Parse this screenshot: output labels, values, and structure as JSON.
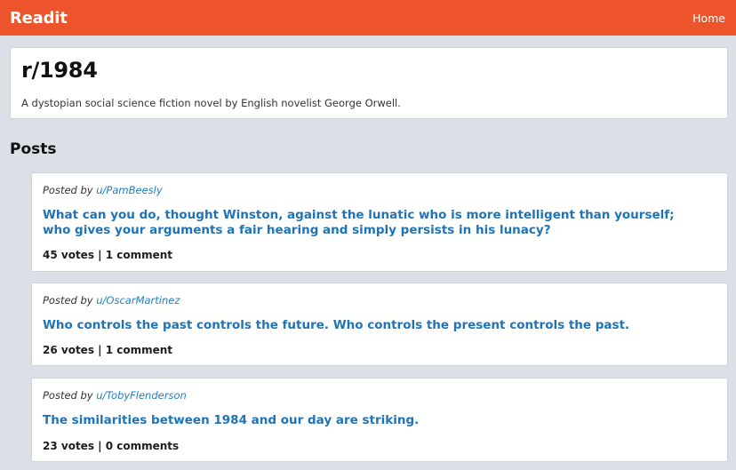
{
  "header": {
    "brand": "Readit",
    "home_label": "Home"
  },
  "subreddit": {
    "name": "r/1984",
    "description": "A dystopian social science fiction novel by English novelist George Orwell."
  },
  "posts_section": {
    "title": "Posts"
  },
  "posts": [
    {
      "posted_by_label": "Posted by",
      "author": "u/PamBeesly",
      "title": "What can you do, thought Winston, against the lunatic who is more intelligent than yourself; who gives your arguments a fair hearing and simply persists in his lunacy?",
      "stats": "45 votes | 1 comment"
    },
    {
      "posted_by_label": "Posted by",
      "author": "u/OscarMartinez",
      "title": "Who controls the past controls the future. Who controls the present controls the past.",
      "stats": "26 votes | 1 comment"
    },
    {
      "posted_by_label": "Posted by",
      "author": "u/TobyFlenderson",
      "title": "The similarities between 1984 and our day are striking.",
      "stats": "23 votes | 0 comments"
    }
  ],
  "colors": {
    "header_bg": "#ee542b",
    "page_bg": "#dae0e6",
    "link": "#1f73b7"
  }
}
